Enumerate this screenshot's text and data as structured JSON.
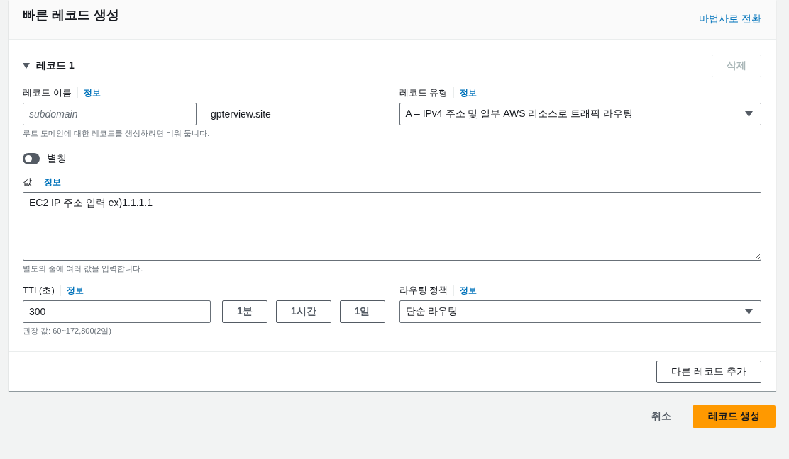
{
  "header": {
    "title": "빠른 레코드 생성",
    "wizard_link": "마법사로 전환"
  },
  "record": {
    "title": "레코드 1",
    "expanded": true,
    "delete_button": {
      "label": "삭제",
      "disabled": true
    },
    "record_name": {
      "label": "레코드 이름",
      "info": "정보",
      "placeholder": "subdomain",
      "suffix": "gpterview.site",
      "hint": "루트 도메인에 대한 레코드를 생성하려면 비워 둡니다."
    },
    "record_type": {
      "label": "레코드 유형",
      "info": "정보",
      "value": "A – IPv4 주소 및 일부 AWS 리소스로 트래픽 라우팅"
    },
    "alias": {
      "label": "별칭",
      "on": false
    },
    "value": {
      "label": "값",
      "info": "정보",
      "value": "EC2 IP 주소 입력 ex)1.1.1.1",
      "hint": "별도의 줄에 여러 값을 입력합니다."
    },
    "ttl": {
      "label": "TTL(초)",
      "info": "정보",
      "value": "300",
      "presets": [
        "1분",
        "1시간",
        "1일"
      ],
      "hint": "권장 값: 60~172,800(2일)"
    },
    "routing_policy": {
      "label": "라우팅 정책",
      "info": "정보",
      "value": "단순 라우팅"
    }
  },
  "add_record_button": "다른 레코드 추가",
  "footer": {
    "cancel": "취소",
    "submit": "레코드 생성"
  }
}
